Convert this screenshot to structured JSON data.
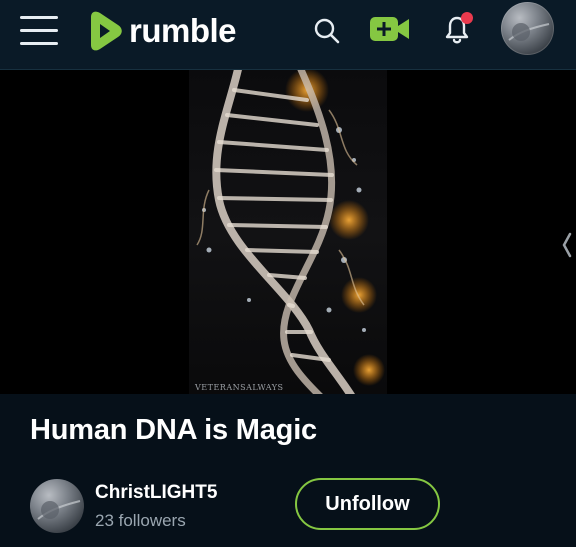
{
  "header": {
    "brand": "rumble",
    "brand_color": "#85c742",
    "icons": [
      "menu-icon",
      "search-icon",
      "upload-video-icon",
      "bell-icon",
      "user-avatar"
    ],
    "notification_dot_color": "#e93a4e"
  },
  "video": {
    "title": "Human DNA is Magic",
    "watermark": "VETERANSALWAYS"
  },
  "channel": {
    "name": "ChristLIGHT5",
    "followers": "23 followers",
    "follow_button_label": "Unfollow"
  }
}
